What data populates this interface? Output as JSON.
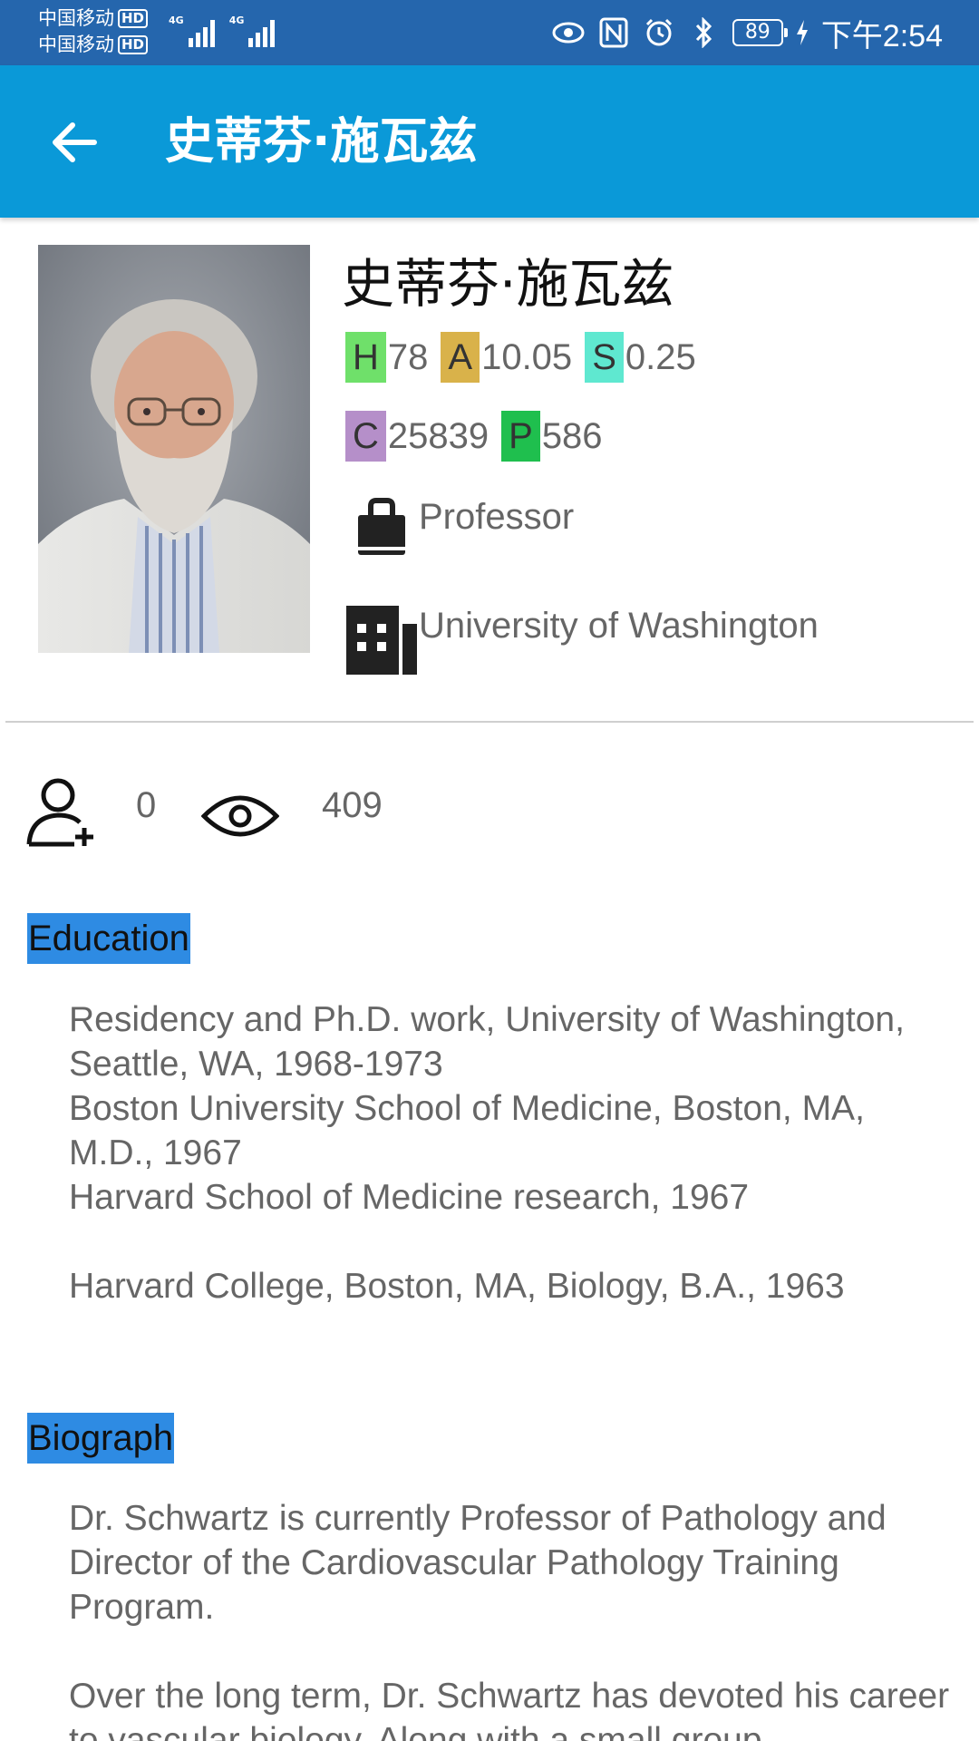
{
  "status_bar": {
    "carrier_1": "中国移动",
    "carrier_2": "中国移动",
    "hd_label": "HD",
    "network_1": "4G",
    "network_2": "4G",
    "battery": "89",
    "time": "下午2:54",
    "icons": [
      "eye-icon",
      "nfc-icon",
      "alarm-icon",
      "bluetooth-icon",
      "battery-icon",
      "charging-icon"
    ]
  },
  "app_bar": {
    "title": "史蒂芬·施瓦兹",
    "back_icon": "arrow-left-icon"
  },
  "profile": {
    "name": "史蒂芬·施瓦兹",
    "metrics": [
      {
        "key": "H",
        "value": "78",
        "color": "#6fe06a"
      },
      {
        "key": "A",
        "value": "10.05",
        "color": "#d9b24a"
      },
      {
        "key": "S",
        "value": "0.25",
        "color": "#5fe8d0"
      },
      {
        "key": "C",
        "value": "25839",
        "color": "#b58fc9"
      },
      {
        "key": "P",
        "value": "586",
        "color": "#1fbf4e"
      }
    ],
    "position": "Professor",
    "affiliation": "University of Washington"
  },
  "stats": {
    "followers": "0",
    "views": "409"
  },
  "education": {
    "title": "Education",
    "items": [
      "Residency and Ph.D. work, University of Washington, Seattle, WA, 1968-1973",
      "Boston University School of Medicine, Boston, MA, M.D., 1967",
      "Harvard School of Medicine research, 1967",
      "Harvard College, Boston, MA, Biology, B.A., 1963"
    ]
  },
  "biography": {
    "title": "Biograph",
    "paragraphs": [
      "Dr. Schwartz is currently Professor of Pathology and Director of the Cardiovascular Pathology Training Program.",
      "Over the long term, Dr. Schwartz has devoted his career to vascular biology. Along with a small group"
    ]
  },
  "colors": {
    "status_bar": "#2566ad",
    "app_bar": "#0a99d8",
    "section_highlight": "#2e8be3"
  }
}
